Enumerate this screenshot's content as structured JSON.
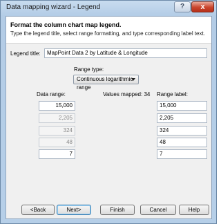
{
  "window": {
    "title": "Data mapping wizard - Legend",
    "help_glyph": "?",
    "close_glyph": "x"
  },
  "header": {
    "title": "Format the column chart map legend.",
    "subtitle": "Type the legend title, select range formatting, and type corresponding label text."
  },
  "legend": {
    "title_label": "Legend title:",
    "title_value": "MapPoint Data 2 by Latitude & Longitude"
  },
  "range_type": {
    "label": "Range type:",
    "selected": "Continuous logarithmic range"
  },
  "columns": {
    "data_range": "Data range:",
    "values_mapped": "Values mapped: 34",
    "range_label": "Range label:"
  },
  "rows": [
    {
      "data": "15,000",
      "label": "15,000",
      "data_enabled": true
    },
    {
      "data": "2,205",
      "label": "2,205",
      "data_enabled": false
    },
    {
      "data": "324",
      "label": "324",
      "data_enabled": false
    },
    {
      "data": "48",
      "label": "48",
      "data_enabled": false
    },
    {
      "data": "7",
      "label": "7",
      "data_enabled": true
    }
  ],
  "buttons": {
    "back": "<Back",
    "next": "Next>",
    "finish": "Finish",
    "cancel": "Cancel",
    "help": "Help"
  }
}
